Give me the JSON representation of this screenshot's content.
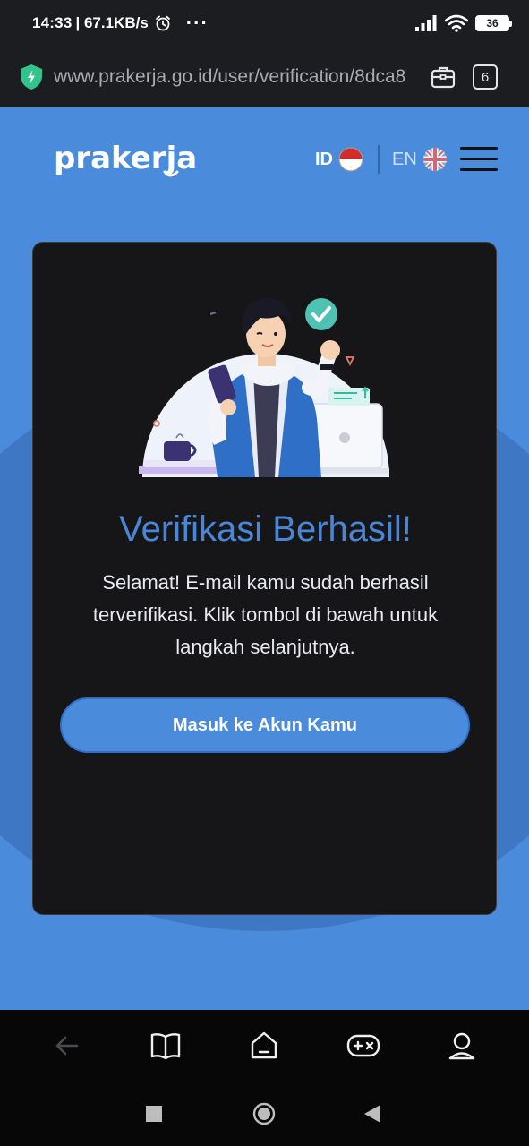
{
  "status_bar": {
    "time": "14:33",
    "speed": "| 67.1KB/s",
    "more": "···",
    "battery": "36"
  },
  "address_bar": {
    "url": "www.prakerja.go.id/user/verification/8dca8",
    "tab_count": "6"
  },
  "header": {
    "logo_text": "prakerja",
    "lang_id": "ID",
    "lang_en": "EN"
  },
  "card": {
    "title": "Verifikasi Berhasil!",
    "description": "Selamat! E-mail kamu sudah berhasil terverifikasi. Klik tombol di bawah untuk langkah selanjutnya.",
    "button_label": "Masuk ke Akun Kamu"
  },
  "colors": {
    "page_bg": "#4a8bdb",
    "card_bg": "#161618",
    "title": "#4a86d6",
    "button": "#4a8bdb"
  },
  "browser_nav": {
    "icons": [
      "back-arrow-icon",
      "book-icon",
      "home-icon",
      "gamepad-icon",
      "profile-icon"
    ]
  },
  "system_nav": {
    "icons": [
      "recents-square-icon",
      "home-circle-icon",
      "back-triangle-icon"
    ]
  }
}
